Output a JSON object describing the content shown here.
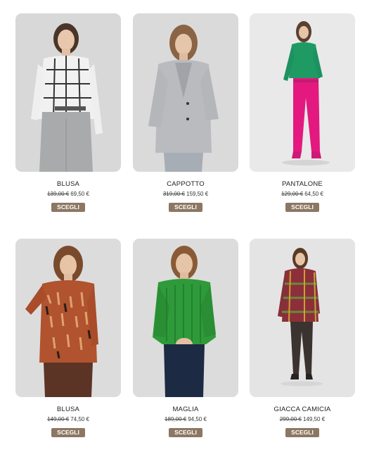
{
  "products": [
    {
      "name": "BLUSA",
      "old_price": "139,00 €",
      "price": "69,50 €",
      "button": "SCEGLI",
      "image_icon": "model-checked-blouse-image",
      "colors": {
        "bg": "#d8d8d8",
        "top": "#f1f1f1",
        "bottom": "#a9aaab",
        "accent": "#333333"
      }
    },
    {
      "name": "CAPPOTTO",
      "old_price": "319,00 €",
      "price": "159,50 €",
      "button": "SCEGLI",
      "image_icon": "model-grey-coat-image",
      "colors": {
        "bg": "#dadada",
        "top": "#b9bbbf",
        "bottom": "#a7adb4",
        "accent": "#7a7d82"
      }
    },
    {
      "name": "PANTALONE",
      "old_price": "129,00 €",
      "price": "64,50 €",
      "button": "SCEGLI",
      "image_icon": "model-pink-trousers-image",
      "colors": {
        "bg": "#e9e9e9",
        "top": "#1f9a63",
        "bottom": "#e3197f",
        "accent": "#c21a72"
      }
    },
    {
      "name": "BLUSA",
      "old_price": "149,00 €",
      "price": "74,50 €",
      "button": "SCEGLI",
      "image_icon": "model-printed-blouse-image",
      "colors": {
        "bg": "#dcdcdc",
        "top": "#b0532e",
        "bottom": "#5b3425",
        "accent": "#e0a26d"
      }
    },
    {
      "name": "MAGLIA",
      "old_price": "189,00 €",
      "price": "94,50 €",
      "button": "SCEGLI",
      "image_icon": "model-green-sweater-image",
      "colors": {
        "bg": "#dcdcdc",
        "top": "#2f9a3a",
        "bottom": "#1d2a44",
        "accent": "#1e7a2a"
      }
    },
    {
      "name": "GIACCA CAMICIA",
      "old_price": "299,00 €",
      "price": "149,50 €",
      "button": "SCEGLI",
      "image_icon": "model-check-shirt-jacket-image",
      "colors": {
        "bg": "#e4e4e4",
        "top": "#8c2f3a",
        "bottom": "#3b3330",
        "accent": "#6a8a3a"
      }
    }
  ]
}
